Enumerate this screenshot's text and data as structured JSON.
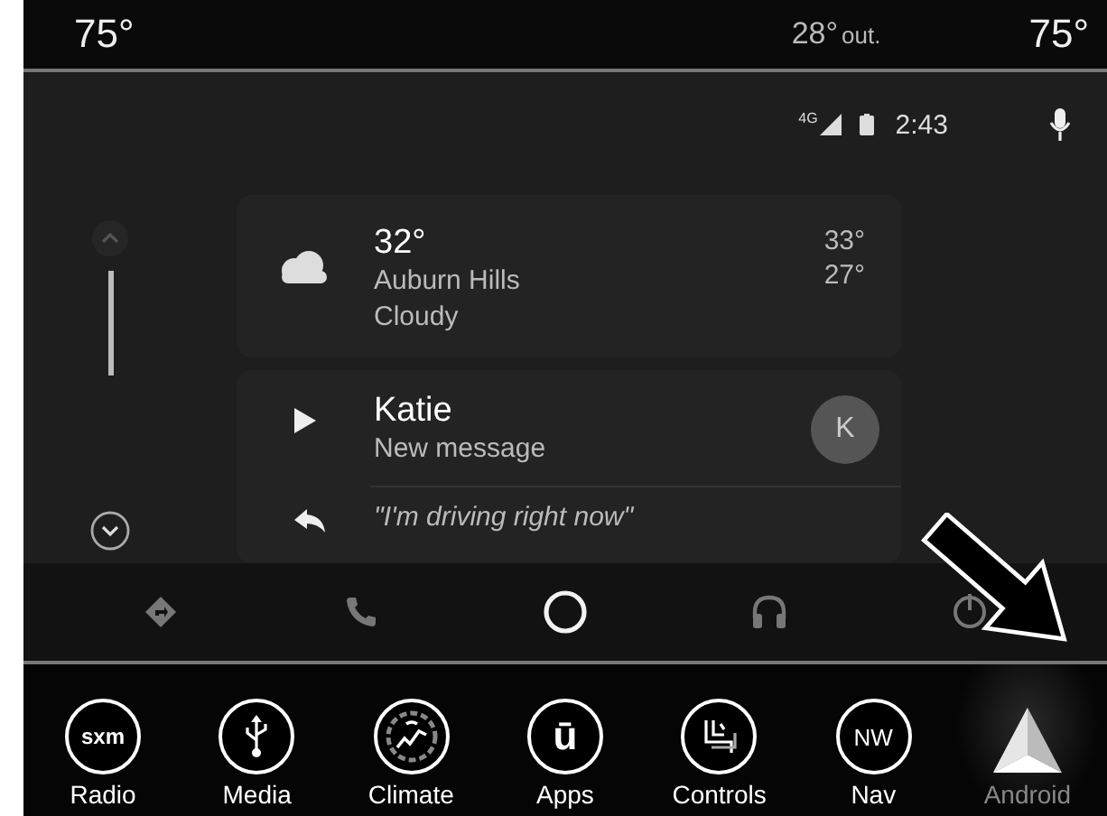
{
  "climate_bar": {
    "driver_temp": "75°",
    "outside_temp": "28°",
    "outside_label": "out.",
    "passenger_temp": "75°"
  },
  "status": {
    "network": "4G",
    "time": "2:43"
  },
  "weather_card": {
    "temperature": "32°",
    "location": "Auburn Hills",
    "condition": "Cloudy",
    "high": "33°",
    "low": "27°"
  },
  "message_card": {
    "sender": "Katie",
    "subtitle": "New message",
    "avatar": "K",
    "reply": "\"I'm driving right now\""
  },
  "nav_bar": [
    {
      "kind": "directions",
      "selected": false
    },
    {
      "kind": "phone",
      "selected": false
    },
    {
      "kind": "home",
      "selected": true
    },
    {
      "kind": "audio",
      "selected": false
    },
    {
      "kind": "exit",
      "selected": false
    }
  ],
  "dock": [
    {
      "kind": "sxm",
      "icon_text": "sxm",
      "label": "Radio",
      "selected": false
    },
    {
      "kind": "usb",
      "label": "Media",
      "selected": false
    },
    {
      "kind": "climate",
      "label": "Climate",
      "selected": false
    },
    {
      "kind": "uconnect",
      "icon_text": "ū",
      "label": "Apps",
      "selected": false
    },
    {
      "kind": "controls",
      "label": "Controls",
      "selected": false
    },
    {
      "kind": "nav",
      "icon_text": "NW",
      "label": "Nav",
      "selected": false
    },
    {
      "kind": "android",
      "label": "Android",
      "selected": true
    }
  ]
}
